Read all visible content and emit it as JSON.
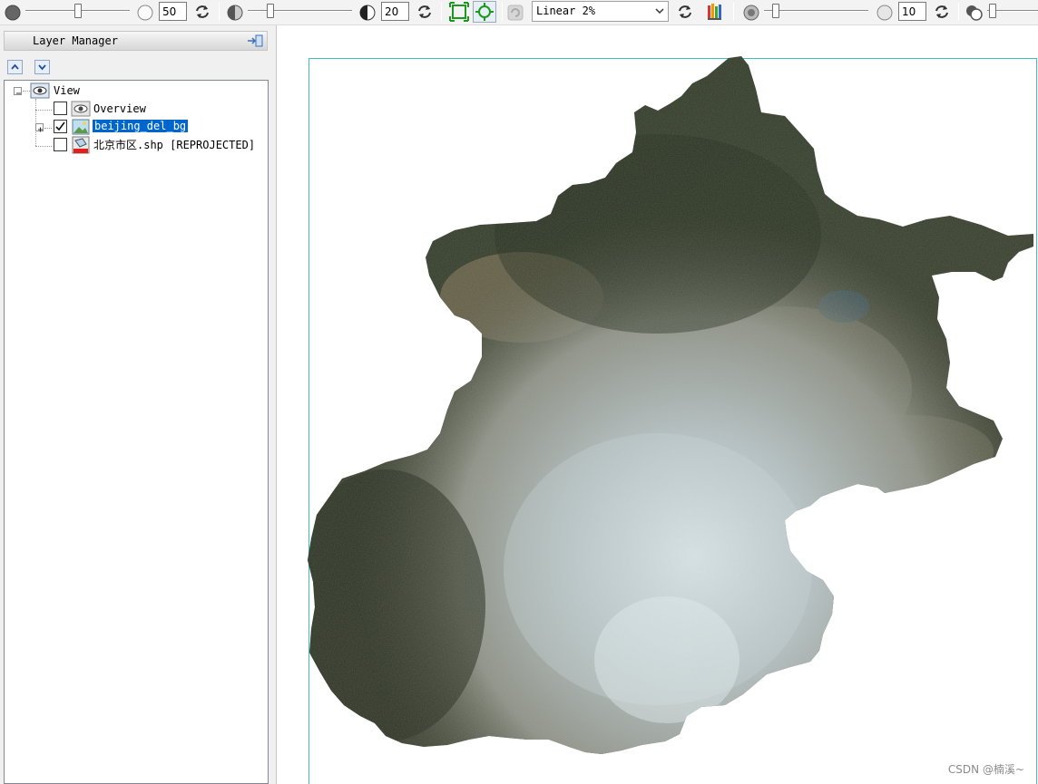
{
  "toolbar": {
    "brightness_value": "50",
    "contrast_value": "20",
    "stretch": {
      "selected": "Linear 2%"
    },
    "transparency_value": "10",
    "brightness_level": 0.5,
    "contrast_level": 0.2,
    "transparency_level": 0.1
  },
  "layer_manager": {
    "title": "Layer Manager",
    "tree": {
      "root": {
        "label": "View"
      },
      "layers": [
        {
          "label": "Overview",
          "checked": false,
          "icon": "overview-eye-icon"
        },
        {
          "label": "beijing_del_bg",
          "checked": true,
          "selected": true,
          "icon": "raster-icon"
        },
        {
          "label": "北京市区.shp [REPROJECTED]",
          "checked": false,
          "icon": "vector-polygon-icon"
        }
      ]
    }
  },
  "map": {
    "extent_border_color": "#3ec0b4",
    "watermark": "CSDN @楠溪~"
  },
  "colors": {
    "selection": "#0066cc",
    "forest": "#2f3a26",
    "urban": "#b7c2c9"
  }
}
